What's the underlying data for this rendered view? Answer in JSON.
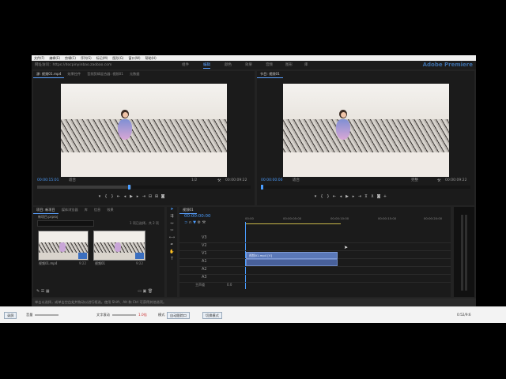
{
  "menu": [
    "文件(F)",
    "编辑(E)",
    "剪辑(C)",
    "序列(S)",
    "标记(M)",
    "图形(G)",
    "窗口(W)",
    "帮助(H)"
  ],
  "url_text": "网址访问：https://docpinyinbao.zaobao.com",
  "workspaces": [
    "组件",
    "编辑",
    "颜色",
    "效果",
    "音频",
    "图形",
    "库"
  ],
  "active_workspace": "编辑",
  "logo": "Adobe Premiere",
  "source_panel": {
    "tabs": [
      "源: 视频01.mp4",
      "效果控件",
      "音频剪辑混合器: 视频01",
      "元数据"
    ],
    "timecode_left": "00:00:15:01",
    "fit": "适合",
    "ratio": "1/2",
    "timecode_right": "00:00:09:22"
  },
  "program_panel": {
    "tabs": [
      "节目: 视频01"
    ],
    "timecode_left": "00:00:00:00",
    "fit": "适合",
    "quality": "完整",
    "timecode_right": "00:00:09:22"
  },
  "project_panel": {
    "tabs": [
      "项目: 新项目",
      "媒体浏览器",
      "库",
      "信息",
      "效果"
    ],
    "path": "新项目.prproj",
    "count": "1 项已选择，共 2 项",
    "items": [
      {
        "name": "视频01.mp4",
        "duration": "9:22"
      },
      {
        "name": "视频01",
        "duration": "9:22"
      }
    ]
  },
  "timeline": {
    "tab": "视频01",
    "timecode": "00:00:00:00",
    "ruler": [
      "00:00",
      "00:00:05:00",
      "00:00:10:00",
      "00:00:15:00",
      "00:00:20:00"
    ],
    "tracks_v": [
      "V3",
      "V2",
      "V1"
    ],
    "tracks_a": [
      "A1",
      "A2",
      "A3"
    ],
    "master": "主声道",
    "master_val": "0.0",
    "clip_v_label": "视频01.mp4 [V]"
  },
  "status_bar": "单击以选择，或单击空白处并拖动以进行框选。使用 Shift、Alt 和 Ctrl 可获得其他选项。",
  "bottom_bar": {
    "record": "录屏",
    "volume": "音量",
    "speed_label": "文字滚动",
    "speed_value": "1.0倍",
    "mode_label": "模式",
    "mode_value": "自动跟踪口",
    "pause": "切换模式",
    "time": "0:52/9:6"
  },
  "colors": {
    "accent": "#4a9dff",
    "panel": "#1b1b1b",
    "app": "#232323"
  }
}
